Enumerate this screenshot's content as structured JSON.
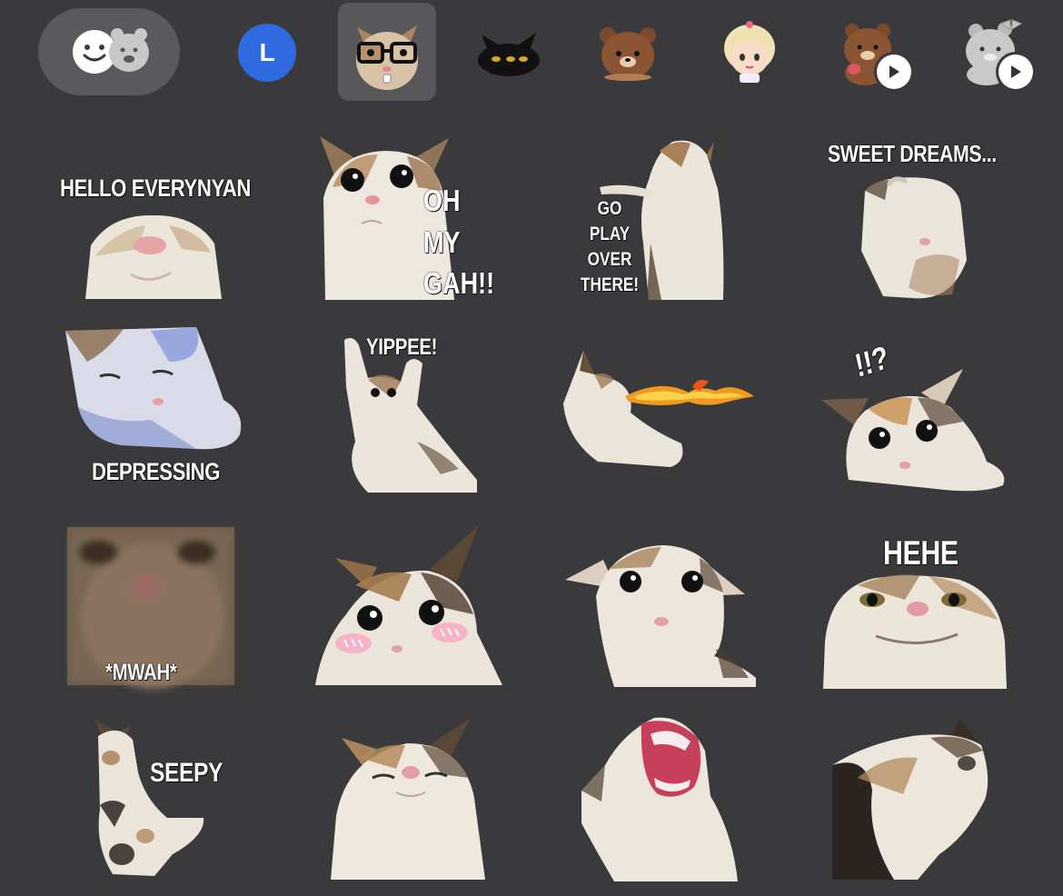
{
  "tabs": {
    "letter_avatar": "L"
  },
  "stickers": {
    "hello_everynyan": "HELLO EVERYNYAN",
    "oh_my_gah": [
      "OH",
      "MY",
      "GAH!!"
    ],
    "go_play_over_there": [
      "GO",
      "PLAY",
      "OVER",
      "THERE!"
    ],
    "sweet_dreams": "SWEET DREAMS...",
    "depressing": "DEPRESSING",
    "yippee": "YIPPEE!",
    "exclaim": "!!?",
    "mwah": "*MWAH*",
    "hehe": "HEHE",
    "seepy": "SEEPY"
  },
  "colors": {
    "background": "#3a3a3c",
    "emoji_tab_bg": "#5a5a5c",
    "selected_tab_bg": "#58585a",
    "avatar_blue": "#2f6ae0",
    "caption_text": "#ffffff"
  }
}
